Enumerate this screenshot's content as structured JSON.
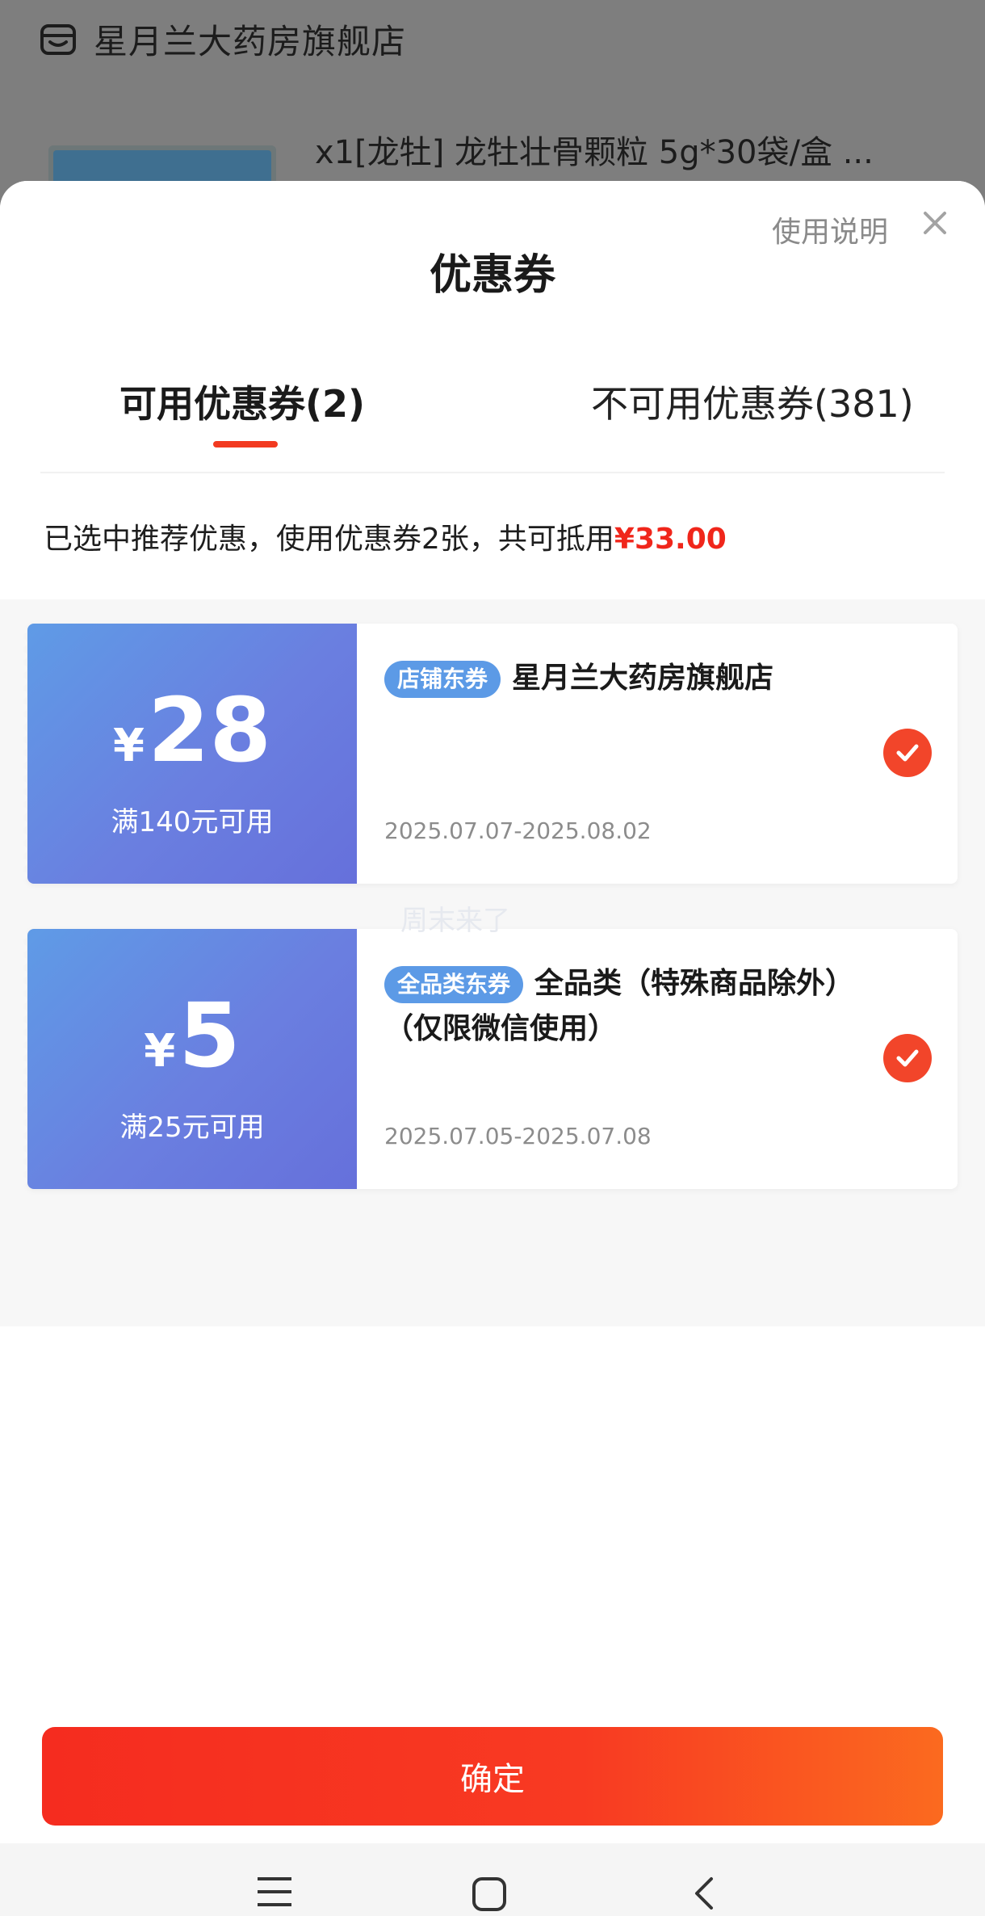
{
  "background": {
    "store_name": "星月兰大药房旗舰店",
    "product_title": "x1[龙牡] 龙牡壮骨颗粒 5g*30袋/盒 ..."
  },
  "sheet": {
    "title": "优惠券",
    "help_link": "使用说明",
    "close_icon": "close-icon",
    "tabs": [
      {
        "label": "可用优惠券(2)",
        "active": true
      },
      {
        "label": "不可用优惠券(381)",
        "active": false
      }
    ],
    "summary": {
      "text": "已选中推荐优惠，使用优惠券2张，共可抵用",
      "amount": "¥33.00"
    }
  },
  "coupons": [
    {
      "currency": "¥",
      "amount": "28",
      "condition": "满140元可用",
      "tag": "店铺东券",
      "title": "星月兰大药房旗舰店",
      "date_range": "2025.07.07-2025.08.02",
      "selected": true
    },
    {
      "currency": "¥",
      "amount": "5",
      "condition": "满25元可用",
      "tag": "全品类东券",
      "title": "全品类（特殊商品除外）（仅限微信使用）",
      "date_range": "2025.07.05-2025.07.08",
      "selected": true
    }
  ],
  "watermark": "周末来了",
  "footer": {
    "confirm_label": "确定"
  },
  "navbar": {
    "icons": [
      "menu-icon",
      "home-icon",
      "back-icon"
    ]
  },
  "colors": {
    "accent": "#f2452a",
    "coupon_blue": "#5f9be6",
    "price_red": "#f0261b"
  }
}
